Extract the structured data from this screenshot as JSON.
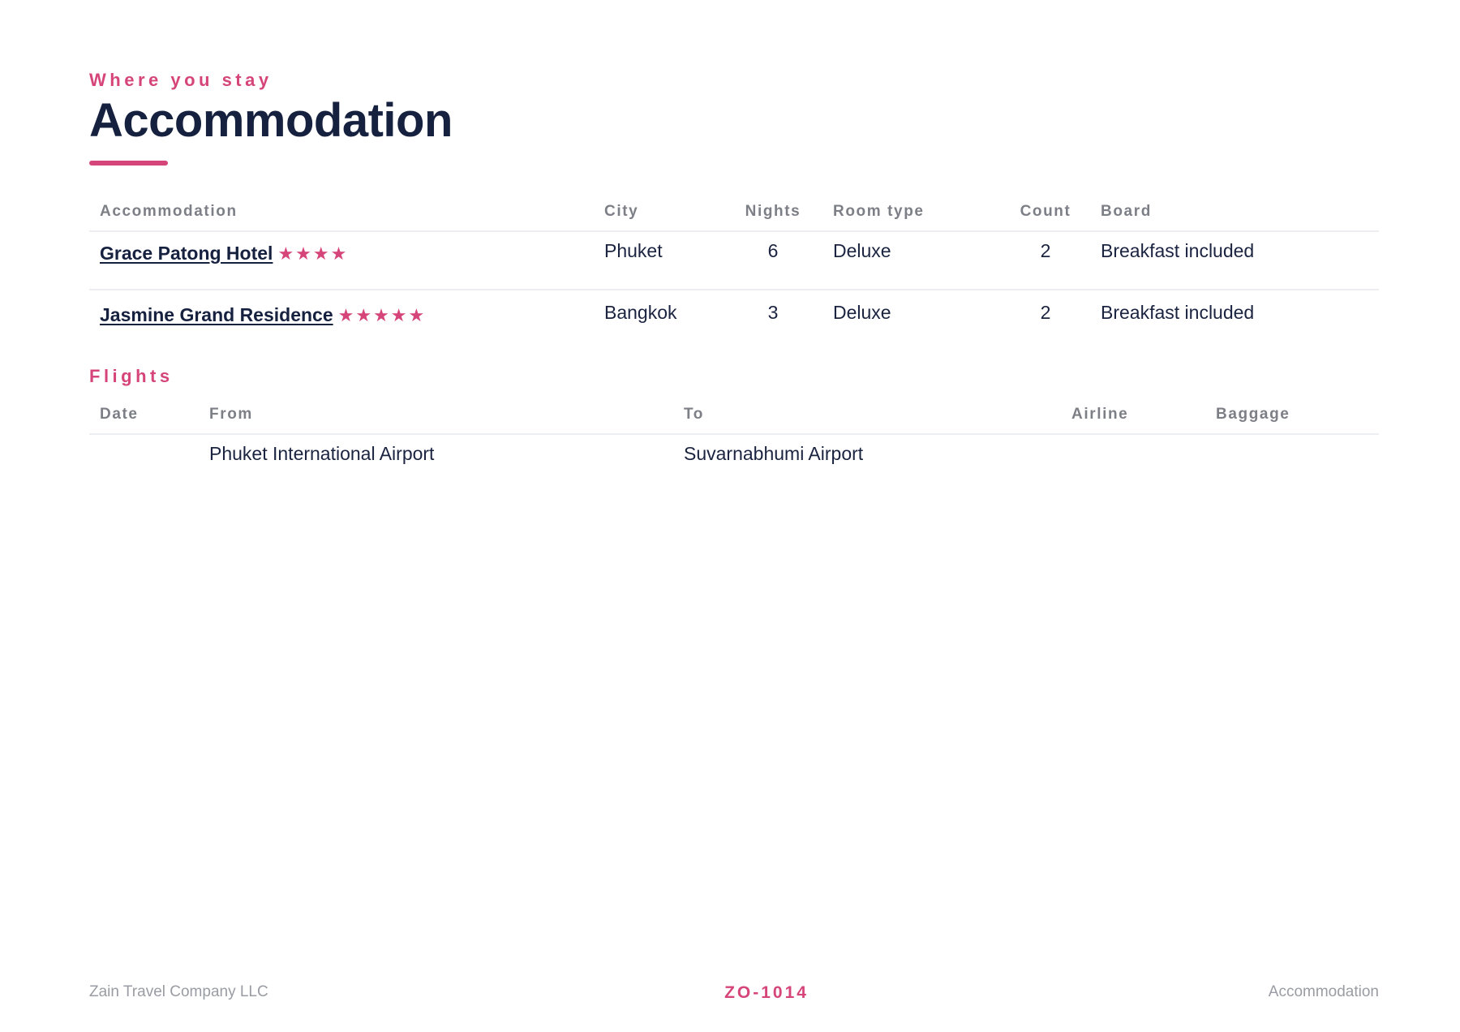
{
  "header": {
    "eyebrow": "Where you stay",
    "title": "Accommodation"
  },
  "accommodation": {
    "columns": [
      "Accommodation",
      "City",
      "Nights",
      "Room type",
      "Count",
      "Board"
    ],
    "rows": [
      {
        "name": "Grace Patong Hotel",
        "stars": "★★★★",
        "star_rating": 4,
        "city": "Phuket",
        "nights": "6",
        "room_type": "Deluxe",
        "count": "2",
        "board": "Breakfast included"
      },
      {
        "name": "Jasmine Grand Residence",
        "stars": "★★★★★",
        "star_rating": 5,
        "city": "Bangkok",
        "nights": "3",
        "room_type": "Deluxe",
        "count": "2",
        "board": "Breakfast included"
      }
    ]
  },
  "flights": {
    "label": "Flights",
    "columns": [
      "Date",
      "From",
      "To",
      "Airline",
      "Baggage"
    ],
    "rows": [
      {
        "date": "",
        "from": "Phuket International Airport",
        "to": "Suvarnabhumi Airport",
        "airline": "",
        "baggage": ""
      }
    ]
  },
  "footer": {
    "company": "Zain Travel Company LLC",
    "reference": "ZO-1014",
    "section": "Accommodation"
  },
  "colors": {
    "accent": "#d6457a",
    "heading": "#16213f",
    "muted": "#7d7f87"
  }
}
